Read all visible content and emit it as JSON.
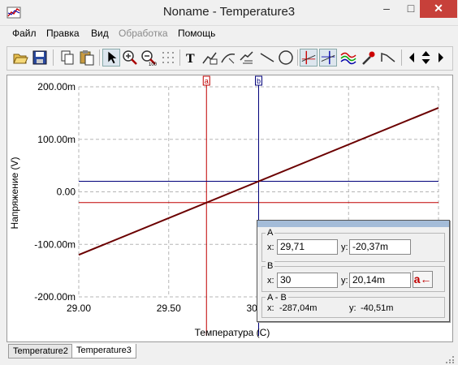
{
  "window": {
    "title": "Noname - Temperature3",
    "minimize": "–",
    "maximize": "□",
    "close": "✕"
  },
  "menu": [
    {
      "label": "Файл",
      "enabled": true
    },
    {
      "label": "Правка",
      "enabled": true
    },
    {
      "label": "Вид",
      "enabled": true
    },
    {
      "label": "Обработка",
      "enabled": false
    },
    {
      "label": "Помощь",
      "enabled": true
    }
  ],
  "toolbar": {
    "icons": [
      "open-folder-icon",
      "save-icon",
      "copy-icon",
      "paste-icon",
      "pointer-icon",
      "zoom-in-icon",
      "zoom-out-icon",
      "zoom-100-icon",
      "grid-icon",
      "text-icon",
      "label-icon",
      "curve-label-icon",
      "box-label-icon",
      "line-icon",
      "ellipse-icon",
      "cursor-a-b-icon",
      "crosshair-icon",
      "plot-style-icon",
      "color-picker-icon",
      "step-icon",
      "scroll-left-icon",
      "scroll-up-down-icon",
      "scroll-right-icon"
    ],
    "text_glyph": "T",
    "zoom_100_label": "100"
  },
  "colors": {
    "trace": "#6b0000",
    "cursor_a": "#c00000",
    "cursor_b": "#00007a",
    "grid": "#b5b5b5"
  },
  "chart_data": {
    "type": "line",
    "xlabel": "Температура (C)",
    "ylabel": "Напряжение (V)",
    "x_ticks": [
      "29.00",
      "29.50",
      "30.00",
      "30.50",
      "31.00"
    ],
    "y_ticks": [
      "200.00m",
      "100.00m",
      "0.00",
      "-100.00m",
      "-200.00m"
    ],
    "xlim": [
      29.0,
      31.0
    ],
    "ylim": [
      -0.2,
      0.2
    ],
    "grid": true,
    "series": [
      {
        "x": [
          29.0,
          31.0
        ],
        "y": [
          -0.12,
          0.16
        ]
      }
    ],
    "cursors": [
      {
        "label": "a",
        "x": 29.71,
        "y": -0.02037
      },
      {
        "label": "b",
        "x": 30.0,
        "y": 0.02014
      }
    ]
  },
  "cursor_panel": {
    "a": {
      "title": "A",
      "x_label": "x:",
      "y_label": "y:",
      "x": "29,71",
      "y": "-20,37m"
    },
    "b": {
      "title": "B",
      "x_label": "x:",
      "y_label": "y:",
      "x": "30",
      "y": "20,14m"
    },
    "diff": {
      "title": "A - B",
      "x_label": "x:",
      "y_label": "y:",
      "x": "-287,04m",
      "y": "-40,51m"
    },
    "swap_label": "a←"
  },
  "tabs": [
    {
      "label": "Temperature2",
      "active": false
    },
    {
      "label": "Temperature3",
      "active": true
    }
  ]
}
